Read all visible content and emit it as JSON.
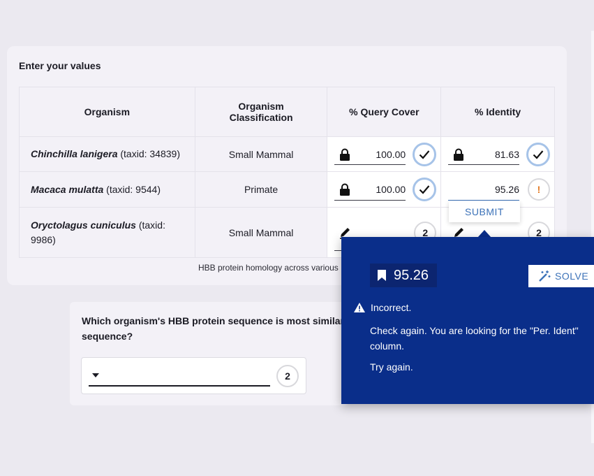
{
  "card": {
    "title": "Enter your values",
    "caption": "HBB protein homology across various"
  },
  "table": {
    "headers": {
      "organism": "Organism",
      "classification_line1": "Organism",
      "classification_line2": "Classification",
      "query_cover": "% Query Cover",
      "identity": "% Identity"
    },
    "rows": [
      {
        "species": "Chinchilla lanigera",
        "taxid": "(taxid: 34839)",
        "classification": "Small Mammal",
        "query_cover": "100.00",
        "identity": "81.63"
      },
      {
        "species": "Macaca mulatta",
        "taxid": "(taxid: 9544)",
        "classification": "Primate",
        "query_cover": "100.00",
        "identity": "95.26"
      },
      {
        "species": "Oryctolagus cuniculus",
        "taxid": "(taxid:",
        "taxid2": "9986)",
        "classification": "Small Mammal",
        "query_cover_attempts": "2",
        "identity_attempts": "2"
      }
    ],
    "warn_symbol": "!"
  },
  "submit": {
    "label": "SUBMIT"
  },
  "question": {
    "text": "Which organism's HBB protein sequence is most similar",
    "text2": "sequence?",
    "attempts": "2"
  },
  "feedback": {
    "answer": "95.26",
    "solve_label": "SOLVE",
    "status": "Incorrect.",
    "message": "Check again. You are looking for the \"Per. Ident\" column.",
    "try_again": "Try again."
  },
  "colors": {
    "popup_bg": "#0a2e8a",
    "accent": "#3c72b8",
    "warning": "#e37a24",
    "check_ring": "#a6c3e8"
  },
  "icons": [
    "lock-icon",
    "check-icon",
    "pencil-icon",
    "bookmark-icon",
    "magic-wand-icon",
    "warning-icon",
    "caret-down-icon"
  ]
}
